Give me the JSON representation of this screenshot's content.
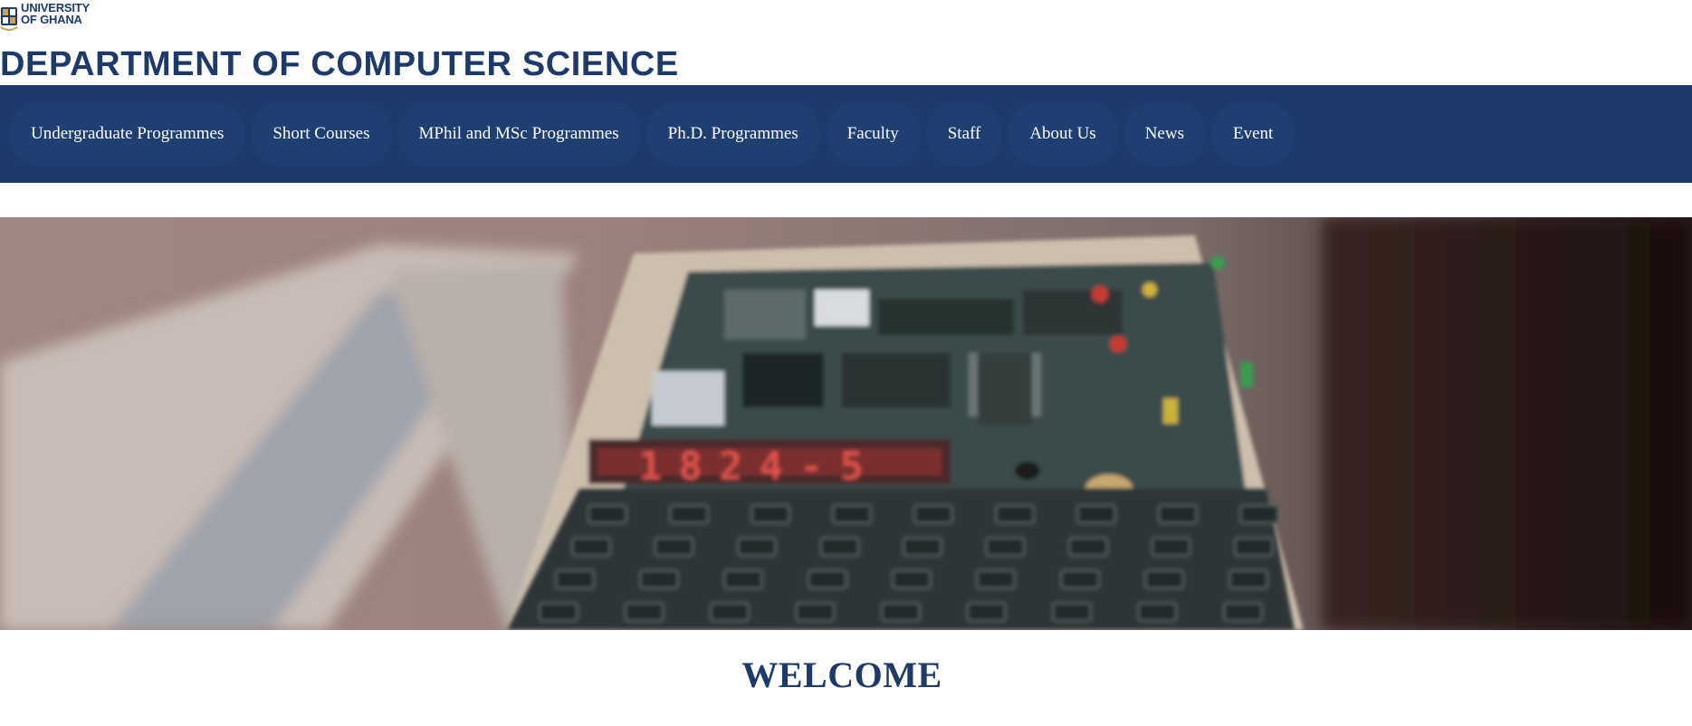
{
  "brand": {
    "line1": "UNIVERSITY",
    "line2": "OF GHANA",
    "logo_icon": "university-crest-icon",
    "color": "#1d3a6b"
  },
  "header": {
    "title": "DEPARTMENT OF COMPUTER SCIENCE"
  },
  "nav": {
    "background": "#1d3a6b",
    "items": [
      {
        "label": "Undergraduate Programmes"
      },
      {
        "label": "Short Courses"
      },
      {
        "label": "MPhil and MSc Programmes"
      },
      {
        "label": "Ph.D. Programmes"
      },
      {
        "label": "Faculty"
      },
      {
        "label": "Staff"
      },
      {
        "label": "About Us"
      },
      {
        "label": "News"
      },
      {
        "label": "Event"
      }
    ]
  },
  "hero": {
    "display_text": "1824-5"
  },
  "welcome": {
    "heading": "WELCOME"
  }
}
